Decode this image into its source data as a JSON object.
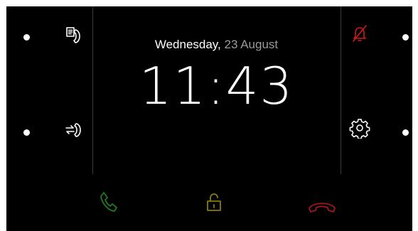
{
  "clock": {
    "weekday": "Wednesday,",
    "day_month": "23 August",
    "time": "11:43"
  },
  "icons": {
    "call_log": "call-log-icon",
    "call_forward": "call-forward-icon",
    "mute": "bell-off-icon",
    "settings": "gear-icon",
    "answer": "phone-answer-icon",
    "unlock": "unlock-icon",
    "hangup": "phone-hangup-icon"
  },
  "colors": {
    "background": "#000000",
    "answer": "#1f7a1f",
    "unlock": "#8a7a10",
    "hangup": "#a01818",
    "mute": "#cc1a1a"
  }
}
